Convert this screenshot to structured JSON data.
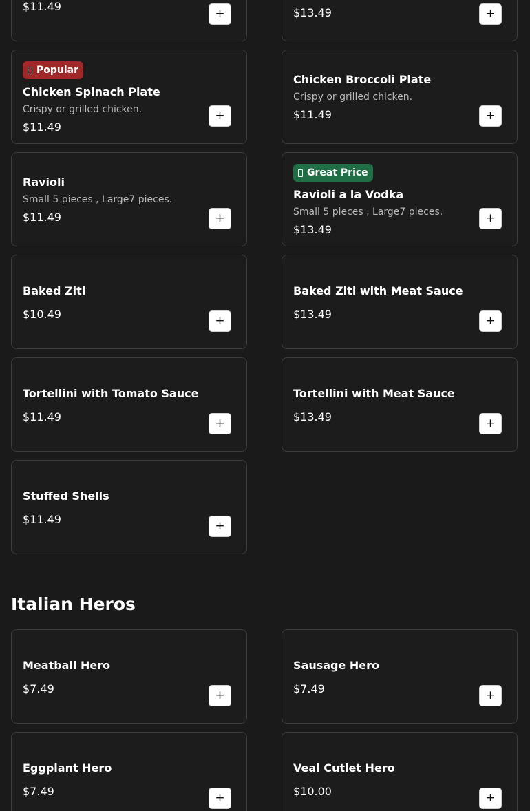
{
  "items": [
    {
      "price": "$11.49",
      "add_label": "+"
    },
    {
      "price": "$13.49",
      "add_label": "+"
    },
    {
      "badge": "Popular",
      "title": "Chicken Spinach Plate",
      "desc": "Crispy or grilled chicken.",
      "price": "$11.49",
      "add_label": "+"
    },
    {
      "title": "Chicken Broccoli Plate",
      "desc": "Crispy or grilled chicken.",
      "price": "$11.49",
      "add_label": "+"
    },
    {
      "title": "Ravioli",
      "desc": "Small 5 pieces , Large7 pieces.",
      "price": "$11.49",
      "add_label": "+"
    },
    {
      "badge": "Great Price",
      "title": "Ravioli a la Vodka",
      "desc": "Small 5 pieces , Large7 pieces.",
      "price": "$13.49",
      "add_label": "+"
    },
    {
      "title": "Baked Ziti",
      "price": "$10.49",
      "add_label": "+"
    },
    {
      "title": "Baked Ziti with Meat Sauce",
      "price": "$13.49",
      "add_label": "+"
    },
    {
      "title": "Tortellini with Tomato Sauce",
      "price": "$11.49",
      "add_label": "+"
    },
    {
      "title": "Tortellini with Meat Sauce",
      "price": "$13.49",
      "add_label": "+"
    },
    {
      "title": "Stuffed Shells",
      "price": "$11.49",
      "add_label": "+"
    }
  ],
  "section": {
    "title": "Italian Heros"
  },
  "heros": [
    {
      "title": "Meatball Hero",
      "price": "$7.49",
      "add_label": "+"
    },
    {
      "title": "Sausage Hero",
      "price": "$7.49",
      "add_label": "+"
    },
    {
      "title": "Eggplant Hero",
      "price": "$7.49",
      "add_label": "+"
    },
    {
      "title": "Veal Cutlet Hero",
      "price": "$10.00",
      "add_label": "+"
    }
  ],
  "colors": {
    "background": "#1a1a1a",
    "popular_badge": "#a02828",
    "great_price_badge": "#1f6e46"
  },
  "icons": {
    "badge_icon": "tag-icon",
    "add_icon": "plus-icon"
  }
}
